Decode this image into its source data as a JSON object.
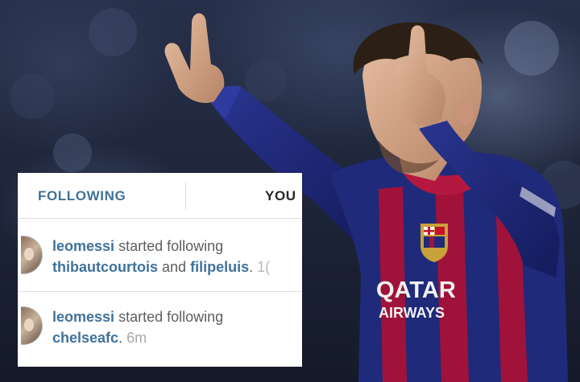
{
  "tabs": {
    "following": "FOLLOWING",
    "you": "YOU"
  },
  "notifications": [
    {
      "username": "leomessi",
      "action": "started following",
      "target_1": "thibautcourtois",
      "joiner": "and",
      "target_2": "filipeluis",
      "time": "1("
    },
    {
      "username": "leomessi",
      "action": "started following",
      "target_1": "chelseafc",
      "time": "6m"
    }
  ],
  "jersey": {
    "sponsor_line_1": "QATAR",
    "sponsor_line_2": "AIRWAYS"
  },
  "colors": {
    "instagram_link_blue": "#3f729b",
    "jersey_blue": "#1f2a7a",
    "jersey_red": "#a0123a"
  }
}
